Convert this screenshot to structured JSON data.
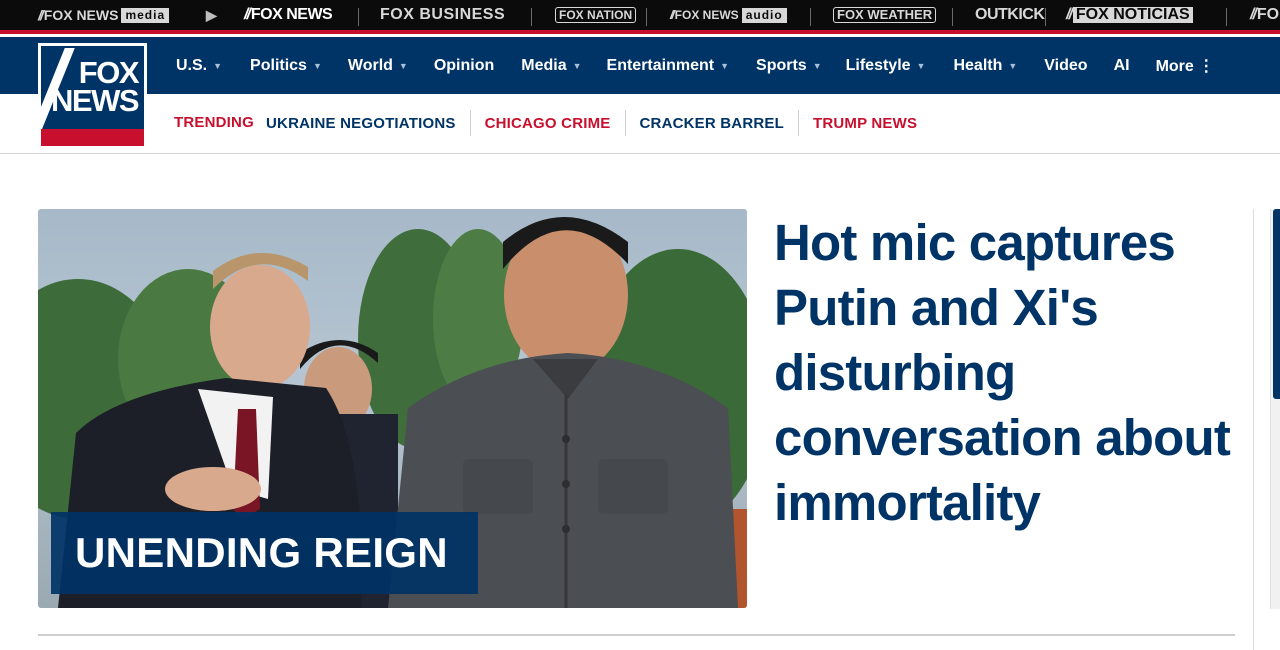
{
  "network": {
    "items": [
      {
        "id": "media",
        "word": "FOX NEWS",
        "box": "media"
      },
      {
        "id": "play",
        "glyph": "▶"
      },
      {
        "id": "news",
        "word": "FOX NEWS"
      },
      {
        "id": "business",
        "word": "FOX BUSINESS"
      },
      {
        "id": "nation",
        "word": "FOX NATION"
      },
      {
        "id": "audio",
        "word": "FOX NEWS",
        "box": "audio"
      },
      {
        "id": "weather",
        "word": "FOX WEATHER"
      },
      {
        "id": "outkick",
        "word": "OUTKICK"
      },
      {
        "id": "noticias",
        "word": "FOX NOTICIAS"
      },
      {
        "id": "cut",
        "word": "FO"
      }
    ]
  },
  "logo": {
    "line1": "FOX",
    "line2": "NEWS"
  },
  "nav": {
    "items": [
      {
        "label": "U.S.",
        "has_menu": true
      },
      {
        "label": "Politics",
        "has_menu": true
      },
      {
        "label": "World",
        "has_menu": true
      },
      {
        "label": "Opinion",
        "has_menu": false
      },
      {
        "label": "Media",
        "has_menu": true
      },
      {
        "label": "Entertainment",
        "has_menu": true
      },
      {
        "label": "Sports",
        "has_menu": true
      },
      {
        "label": "Lifestyle",
        "has_menu": true
      },
      {
        "label": "Health",
        "has_menu": true
      },
      {
        "label": "Video",
        "has_menu": false
      },
      {
        "label": "AI",
        "has_menu": false
      },
      {
        "label": "More ⋮",
        "has_menu": false
      }
    ]
  },
  "trending": {
    "label": "TRENDING",
    "items": [
      {
        "label": "UKRAINE NEGOTIATIONS",
        "color": "#003366"
      },
      {
        "label": "CHICAGO CRIME",
        "color": "#c8102e"
      },
      {
        "label": "CRACKER BARREL",
        "color": "#003366"
      },
      {
        "label": "TRUMP NEWS",
        "color": "#c8102e"
      }
    ]
  },
  "hero": {
    "kicker": "UNENDING REIGN",
    "headline": "Hot mic captures Putin and Xi's disturbing conversation about immortality"
  },
  "colors": {
    "navy": "#003366",
    "red": "#c8102e",
    "topbar": "#0b0b0b"
  }
}
